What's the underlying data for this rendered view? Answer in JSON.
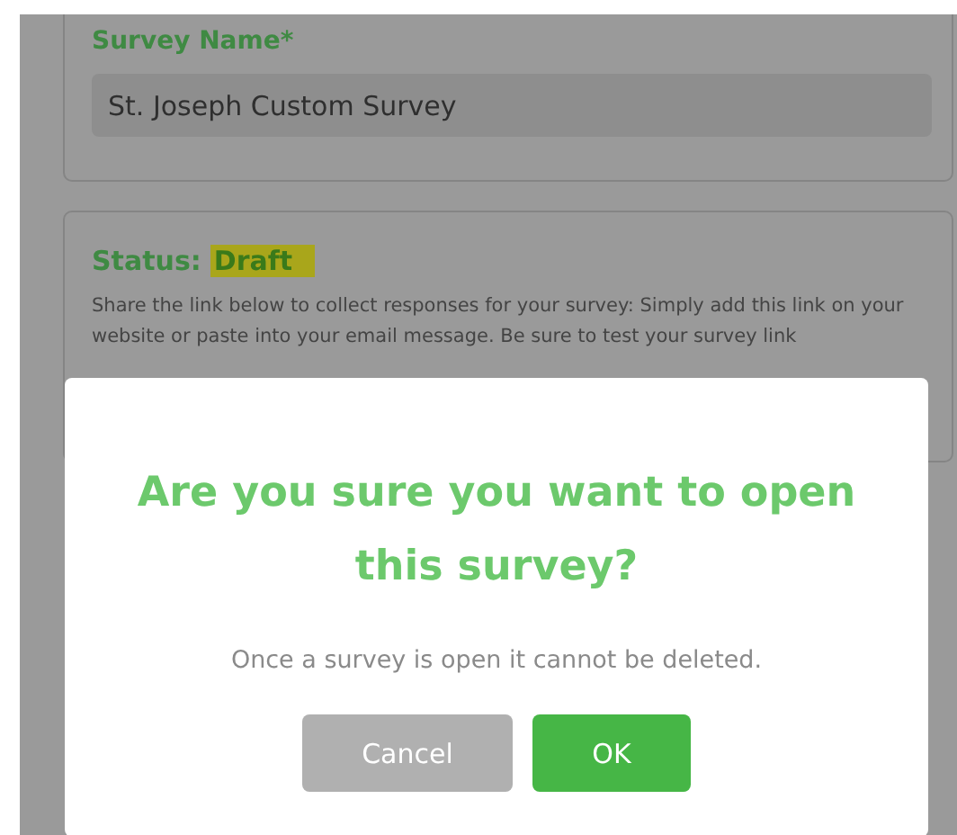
{
  "survey_name": {
    "label": "Survey Name*",
    "value": "St. Joseph Custom Survey"
  },
  "status": {
    "label": "Status:",
    "value": "Draft",
    "description": "Share the link below to collect responses for your survey: Simply add this link on your website or paste into your email message. Be sure to test your survey link"
  },
  "modal": {
    "title": "Are you sure you want to open this survey?",
    "message": "Once a survey is open it cannot be deleted.",
    "buttons": [
      {
        "label": "Cancel",
        "kind": "secondary"
      },
      {
        "label": "OK",
        "kind": "primary"
      }
    ]
  }
}
